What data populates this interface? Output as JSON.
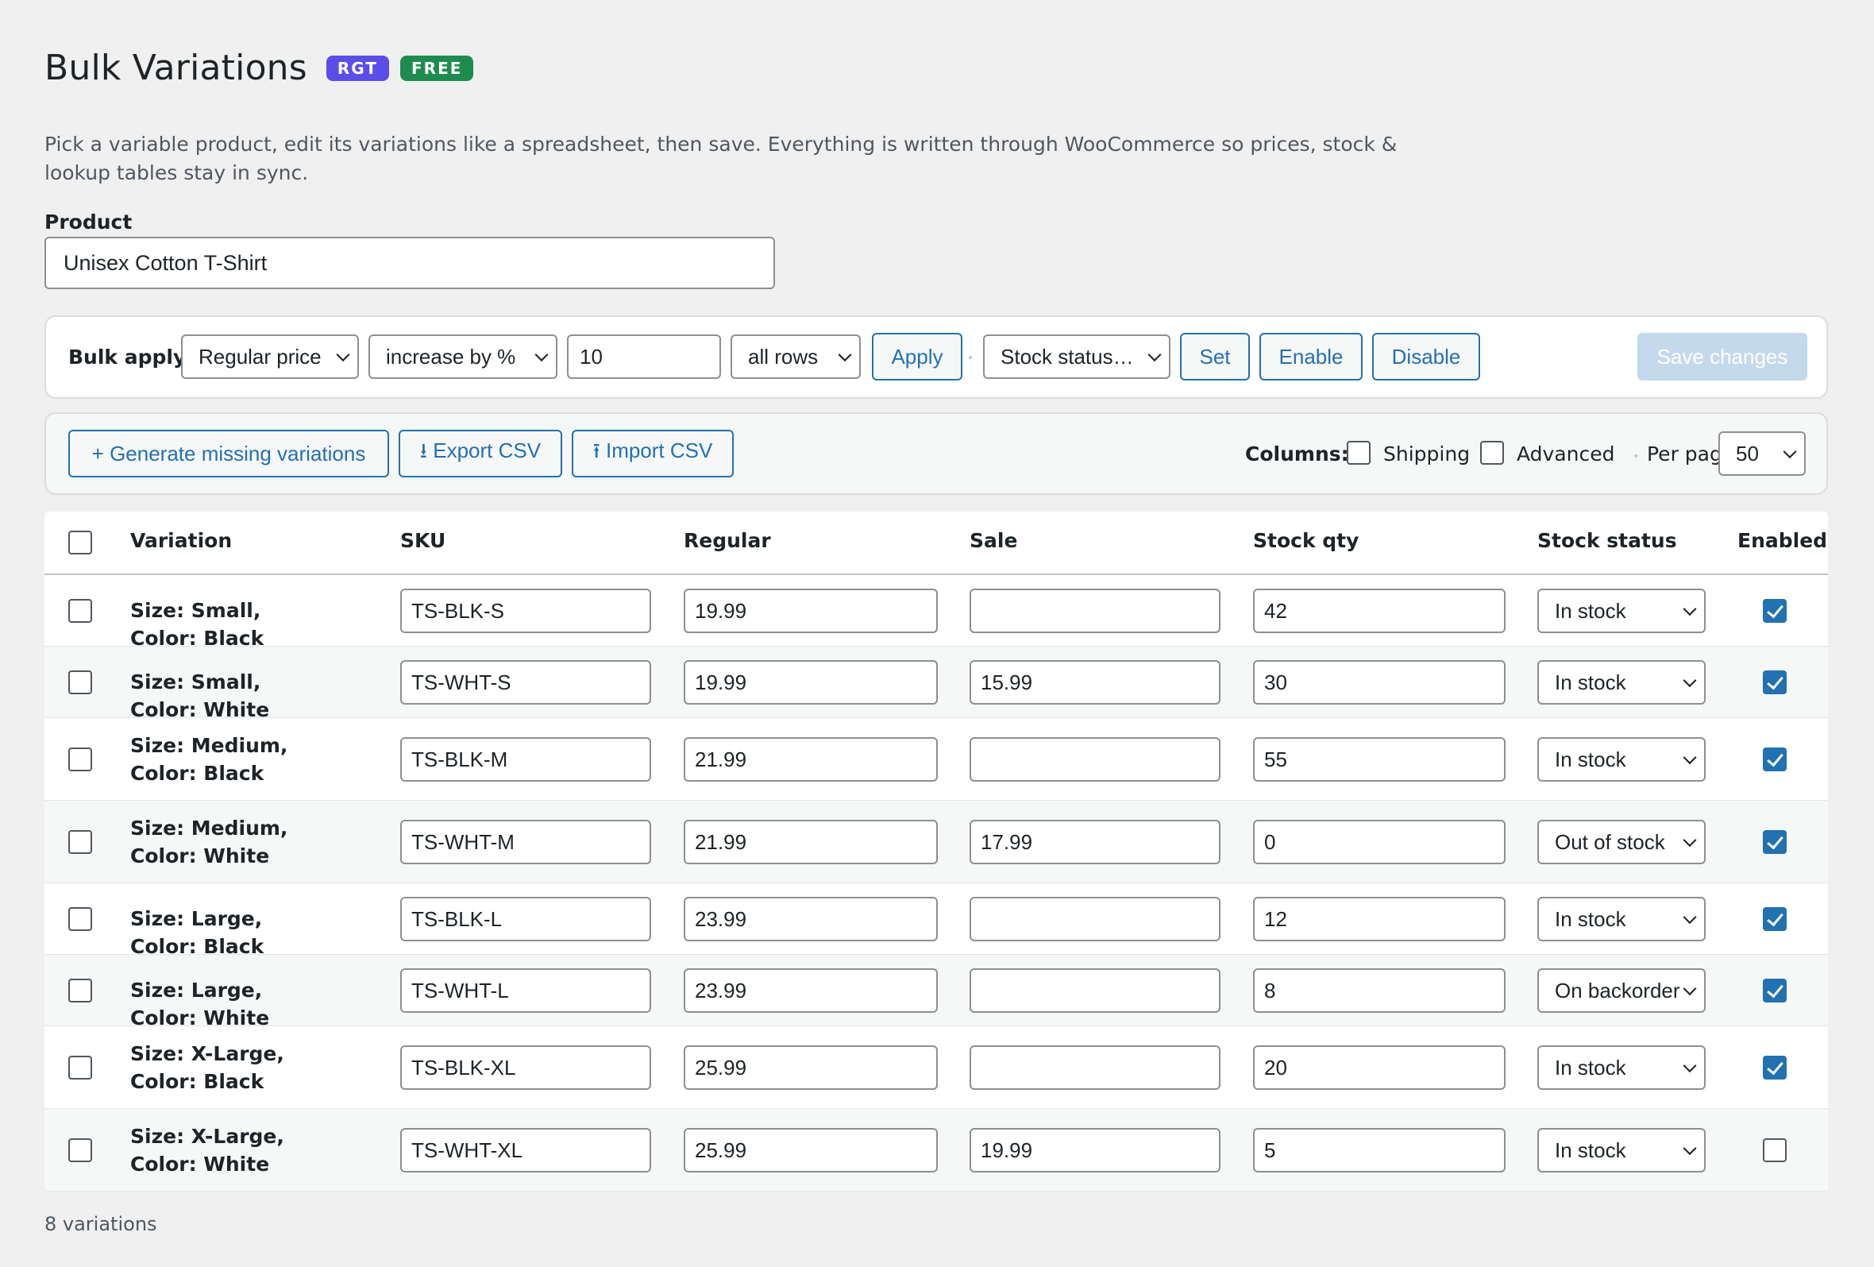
{
  "header": {
    "title": "Bulk Variations",
    "badges": [
      "RGT",
      "FREE"
    ]
  },
  "description": "Pick a variable product, edit its variations like a spreadsheet, then save. Everything is written through WooCommerce so prices, stock & lookup tables stay in sync.",
  "product": {
    "label": "Product",
    "value": "Unisex Cotton T-Shirt"
  },
  "bulk": {
    "label": "Bulk apply:",
    "field": "Regular price",
    "operation": "increase by %",
    "amount": "10",
    "scope": "all rows",
    "apply_label": "Apply",
    "stock_status": "Stock status…",
    "set_label": "Set",
    "enable_label": "Enable",
    "disable_label": "Disable",
    "save_label": "Save changes"
  },
  "tools": {
    "generate_label": "+ Generate missing variations",
    "export_label": "⭳ Export CSV",
    "import_label": "⭱ Import CSV",
    "columns_label": "Columns:",
    "shipping_label": "Shipping",
    "advanced_label": "Advanced",
    "per_page_label": "Per page",
    "per_page_value": "50"
  },
  "table": {
    "headers": [
      "Variation",
      "SKU",
      "Regular",
      "Sale",
      "Stock qty",
      "Stock status",
      "Enabled"
    ],
    "rows": [
      {
        "name": "Size: Small, Color: Black",
        "sku": "TS-BLK-S",
        "regular": "19.99",
        "sale": "",
        "qty": "42",
        "status": "In stock",
        "enabled": true
      },
      {
        "name": "Size: Small, Color: White",
        "sku": "TS-WHT-S",
        "regular": "19.99",
        "sale": "15.99",
        "qty": "30",
        "status": "In stock",
        "enabled": true
      },
      {
        "name": "Size: Medium, Color: Black",
        "sku": "TS-BLK-M",
        "regular": "21.99",
        "sale": "",
        "qty": "55",
        "status": "In stock",
        "enabled": true
      },
      {
        "name": "Size: Medium, Color: White",
        "sku": "TS-WHT-M",
        "regular": "21.99",
        "sale": "17.99",
        "qty": "0",
        "status": "Out of stock",
        "enabled": true
      },
      {
        "name": "Size: Large, Color: Black",
        "sku": "TS-BLK-L",
        "regular": "23.99",
        "sale": "",
        "qty": "12",
        "status": "In stock",
        "enabled": true
      },
      {
        "name": "Size: Large, Color: White",
        "sku": "TS-WHT-L",
        "regular": "23.99",
        "sale": "",
        "qty": "8",
        "status": "On backorder",
        "enabled": true
      },
      {
        "name": "Size: X-Large, Color: Black",
        "sku": "TS-BLK-XL",
        "regular": "25.99",
        "sale": "",
        "qty": "20",
        "status": "In stock",
        "enabled": true
      },
      {
        "name": "Size: X-Large, Color: White",
        "sku": "TS-WHT-XL",
        "regular": "25.99",
        "sale": "19.99",
        "qty": "5",
        "status": "In stock",
        "enabled": false
      }
    ]
  },
  "footer": {
    "count_text": "8 variations"
  },
  "colors": {
    "accent": "#2271b1",
    "badge_rgt": "#5b4de8",
    "badge_free": "#1e8c4e",
    "background": "#f0f0f1"
  }
}
